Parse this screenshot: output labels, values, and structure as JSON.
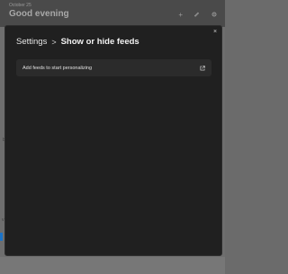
{
  "background": {
    "date_text": "October 25",
    "greeting": "Good evening",
    "side_marks": [
      "b",
      "v"
    ]
  },
  "dialog": {
    "breadcrumb": {
      "parent": "Settings",
      "separator": ">",
      "current": "Show or hide feeds"
    },
    "close_symbol": "×",
    "feeds_row": {
      "label": "Add feeds to start personalizing",
      "icon": "external-link-icon"
    }
  },
  "colors": {
    "dialog_bg": "#202020",
    "row_bg": "#2b2b2b",
    "accent": "#1a73c8"
  }
}
